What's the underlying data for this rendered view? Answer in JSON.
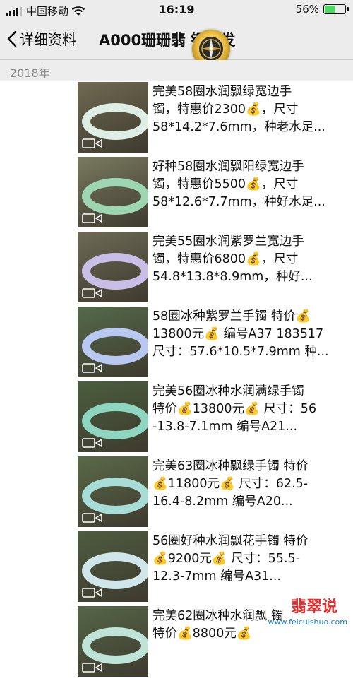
{
  "status_bar": {
    "carrier": "中国移动",
    "time": "16:19",
    "battery_text": "56%",
    "battery_level": 0.56
  },
  "nav": {
    "back_label": "详细资料",
    "title": "A000珊珊翡  镯批发"
  },
  "section": {
    "year": "2018年"
  },
  "items": [
    {
      "lines": [
        "完美58圈水润飘绿宽边手",
        "镯，特惠价2300💰，尺寸",
        "58*14.2*7.6mm，种老水足..."
      ],
      "thumb_colors": {
        "bg": "#6f6a52",
        "ring": "#dfeee4"
      }
    },
    {
      "lines": [
        "好种58圈水润飘阳绿宽边手",
        "镯，特惠价5500💰，尺寸",
        "58*12.6*7.7mm，种好水足..."
      ],
      "thumb_colors": {
        "bg": "#7a7a60",
        "ring": "#9fd6b2"
      }
    },
    {
      "lines": [
        "完美55圈水润紫罗兰宽边手",
        "镯，特惠价6800💰，尺寸",
        "54.8*13.8*8.9mm，种好..."
      ],
      "thumb_colors": {
        "bg": "#6d6a56",
        "ring": "#c9bfe6"
      }
    },
    {
      "lines": [
        "58圈冰种紫罗兰手镯 特价💰",
        "13800元💰 编号A37 183517",
        "尺寸：57.6*10.5*7.9mm 种..."
      ],
      "thumb_colors": {
        "bg": "#556a4a",
        "ring": "#b8c8f0"
      }
    },
    {
      "lines": [
        "完美56圈冰种水润满绿手镯",
        "特价💰13800元💰 尺寸：56",
        "-13.8-7.1mm 编号A21..."
      ],
      "thumb_colors": {
        "bg": "#4a5e3e",
        "ring": "#8fd6c0"
      }
    },
    {
      "lines": [
        "完美63圈冰种飘绿手镯 特价",
        "💰11800元💰 尺寸：62.5-",
        "16.4-8.2mm 编号A20..."
      ],
      "thumb_colors": {
        "bg": "#5a6a48",
        "ring": "#a8dcd6"
      }
    },
    {
      "lines": [
        "56圈好种水润飘花手镯 特价",
        "💰9200元💰 尺寸：55.5-",
        "12.3-7mm 编号A31..."
      ],
      "thumb_colors": {
        "bg": "#4e5c40",
        "ring": "#cfe7ea"
      }
    },
    {
      "lines": [
        "完美62圈冰种水润飘   镯",
        "特价💰8800元💰  ",
        ""
      ],
      "thumb_colors": {
        "bg": "#556648",
        "ring": "#bfe3d6"
      }
    }
  ],
  "watermark": {
    "text": "翡翠说",
    "url": "www.feicuishuo.com"
  }
}
